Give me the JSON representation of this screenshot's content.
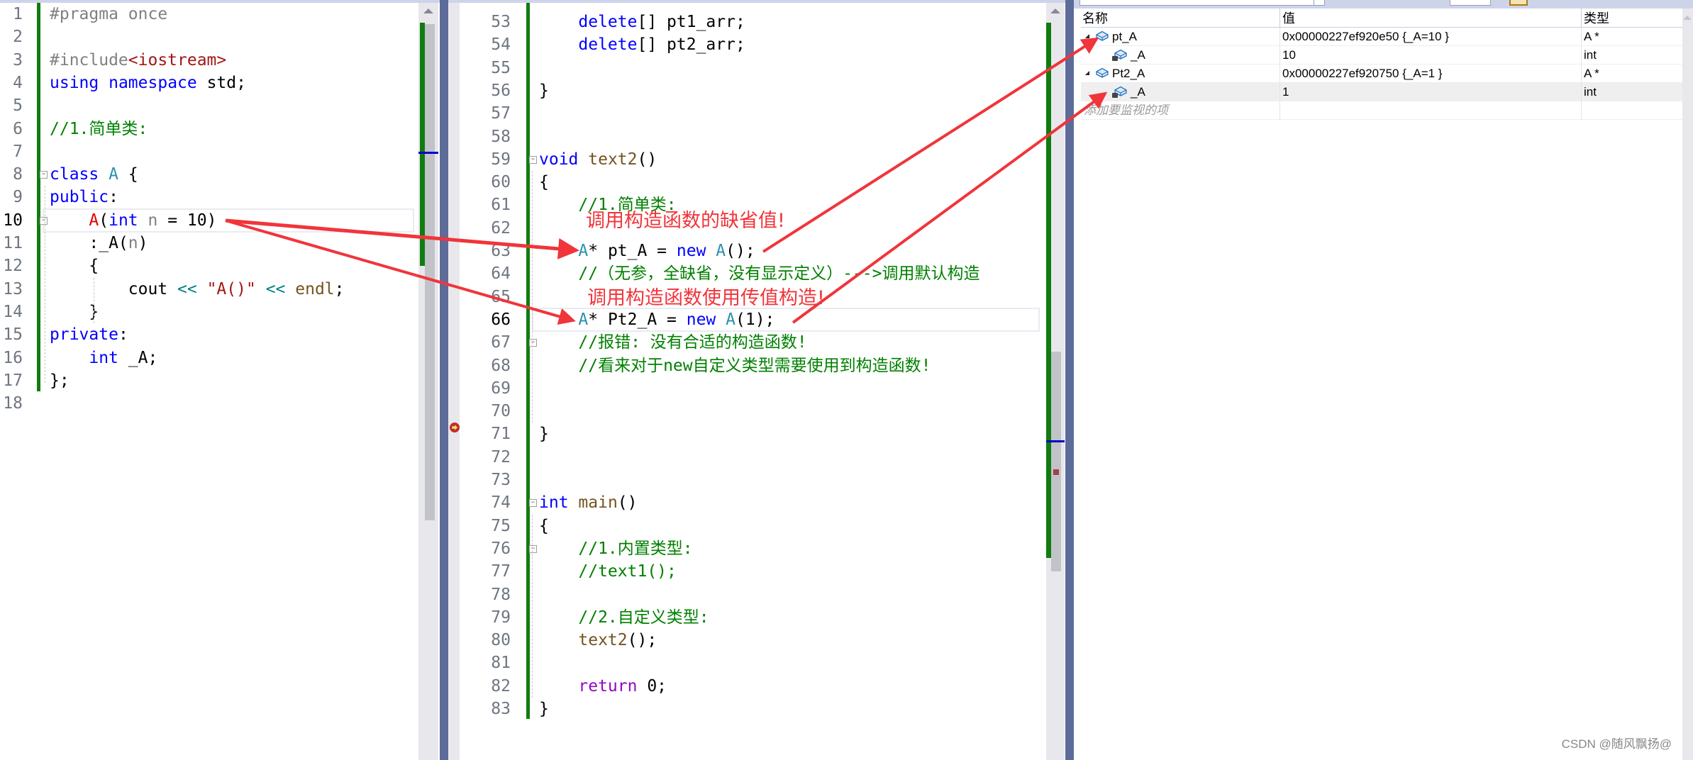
{
  "left_editor": {
    "current_line": 10,
    "lines": [
      {
        "n": "1",
        "tokens": [
          [
            "pre",
            "#pragma once"
          ]
        ]
      },
      {
        "n": "2",
        "tokens": []
      },
      {
        "n": "3",
        "tokens": [
          [
            "pre",
            "#include"
          ],
          [
            "s",
            "<iostream>"
          ]
        ]
      },
      {
        "n": "4",
        "tokens": [
          [
            "k",
            "using"
          ],
          [
            "d",
            " "
          ],
          [
            "k",
            "namespace"
          ],
          [
            "d",
            " std;"
          ]
        ]
      },
      {
        "n": "5",
        "tokens": []
      },
      {
        "n": "6",
        "tokens": [
          [
            "c",
            "//1.简单类:"
          ]
        ]
      },
      {
        "n": "7",
        "tokens": []
      },
      {
        "n": "8",
        "tokens": [
          [
            "k",
            "class"
          ],
          [
            "d",
            " "
          ],
          [
            "t",
            "A"
          ],
          [
            "d",
            " {"
          ]
        ]
      },
      {
        "n": "9",
        "tokens": [
          [
            "k",
            "public"
          ],
          [
            "d",
            ":"
          ]
        ]
      },
      {
        "n": "10",
        "tokens": [
          [
            "d",
            "    "
          ],
          [
            "r",
            "A"
          ],
          [
            "d",
            "("
          ],
          [
            "k",
            "int"
          ],
          [
            "d",
            " "
          ],
          [
            "p",
            "n"
          ],
          [
            "d",
            " = 10)"
          ]
        ]
      },
      {
        "n": "11",
        "tokens": [
          [
            "d",
            "    :_A("
          ],
          [
            "p",
            "n"
          ],
          [
            "d",
            ")"
          ]
        ]
      },
      {
        "n": "12",
        "tokens": [
          [
            "d",
            "    {"
          ]
        ]
      },
      {
        "n": "13",
        "tokens": [
          [
            "d",
            "        cout "
          ],
          [
            "op",
            "<<"
          ],
          [
            "d",
            " "
          ],
          [
            "s",
            "\"A()\""
          ],
          [
            "d",
            " "
          ],
          [
            "op",
            "<<"
          ],
          [
            "d",
            " "
          ],
          [
            "f",
            "endl"
          ],
          [
            "d",
            ";"
          ]
        ]
      },
      {
        "n": "14",
        "tokens": [
          [
            "d",
            "    }"
          ]
        ]
      },
      {
        "n": "15",
        "tokens": [
          [
            "k",
            "private"
          ],
          [
            "d",
            ":"
          ]
        ]
      },
      {
        "n": "16",
        "tokens": [
          [
            "d",
            "    "
          ],
          [
            "k",
            "int"
          ],
          [
            "d",
            " _A;"
          ]
        ]
      },
      {
        "n": "17",
        "tokens": [
          [
            "d",
            "};"
          ]
        ]
      },
      {
        "n": "18",
        "tokens": []
      }
    ]
  },
  "mid_editor": {
    "current_line": 66,
    "lines": [
      {
        "n": "53",
        "tokens": [
          [
            "d",
            "    "
          ],
          [
            "k",
            "delete"
          ],
          [
            "d",
            "[] pt1_arr;"
          ]
        ]
      },
      {
        "n": "54",
        "tokens": [
          [
            "d",
            "    "
          ],
          [
            "k",
            "delete"
          ],
          [
            "d",
            "[] pt2_arr;"
          ]
        ]
      },
      {
        "n": "55",
        "tokens": []
      },
      {
        "n": "56",
        "tokens": [
          [
            "d",
            "}"
          ]
        ]
      },
      {
        "n": "57",
        "tokens": []
      },
      {
        "n": "58",
        "tokens": []
      },
      {
        "n": "59",
        "tokens": [
          [
            "k",
            "void"
          ],
          [
            "d",
            " "
          ],
          [
            "f",
            "text2"
          ],
          [
            "d",
            "()"
          ]
        ]
      },
      {
        "n": "60",
        "tokens": [
          [
            "d",
            "{"
          ]
        ]
      },
      {
        "n": "61",
        "tokens": [
          [
            "d",
            "    "
          ],
          [
            "c",
            "//1.简单类:"
          ]
        ]
      },
      {
        "n": "62",
        "tokens": []
      },
      {
        "n": "63",
        "tokens": [
          [
            "d",
            "    "
          ],
          [
            "t",
            "A"
          ],
          [
            "d",
            "* pt_A = "
          ],
          [
            "k",
            "new"
          ],
          [
            "d",
            " "
          ],
          [
            "t",
            "A"
          ],
          [
            "d",
            "();"
          ]
        ]
      },
      {
        "n": "64",
        "tokens": [
          [
            "d",
            "    "
          ],
          [
            "c",
            "//（无参，全缺省，没有显示定义）--->调用默认构造"
          ]
        ]
      },
      {
        "n": "65",
        "tokens": []
      },
      {
        "n": "66",
        "tokens": [
          [
            "d",
            "    "
          ],
          [
            "t",
            "A"
          ],
          [
            "d",
            "* Pt2_A = "
          ],
          [
            "k",
            "new"
          ],
          [
            "d",
            " "
          ],
          [
            "t",
            "A"
          ],
          [
            "d",
            "(1);"
          ]
        ]
      },
      {
        "n": "67",
        "tokens": [
          [
            "d",
            "    "
          ],
          [
            "c",
            "//报错: 没有合适的构造函数!"
          ]
        ]
      },
      {
        "n": "68",
        "tokens": [
          [
            "d",
            "    "
          ],
          [
            "c",
            "//看来对于new自定义类型需要使用到构造函数!"
          ]
        ]
      },
      {
        "n": "69",
        "tokens": []
      },
      {
        "n": "70",
        "tokens": []
      },
      {
        "n": "71",
        "tokens": [
          [
            "d",
            "}"
          ]
        ]
      },
      {
        "n": "72",
        "tokens": []
      },
      {
        "n": "73",
        "tokens": []
      },
      {
        "n": "74",
        "tokens": [
          [
            "k",
            "int"
          ],
          [
            "d",
            " "
          ],
          [
            "f",
            "main"
          ],
          [
            "d",
            "()"
          ]
        ]
      },
      {
        "n": "75",
        "tokens": [
          [
            "d",
            "{"
          ]
        ]
      },
      {
        "n": "76",
        "tokens": [
          [
            "d",
            "    "
          ],
          [
            "c",
            "//1.内置类型:"
          ]
        ]
      },
      {
        "n": "77",
        "tokens": [
          [
            "d",
            "    "
          ],
          [
            "c",
            "//text1();"
          ]
        ]
      },
      {
        "n": "78",
        "tokens": []
      },
      {
        "n": "79",
        "tokens": [
          [
            "d",
            "    "
          ],
          [
            "c",
            "//2.自定义类型:"
          ]
        ]
      },
      {
        "n": "80",
        "tokens": [
          [
            "d",
            "    "
          ],
          [
            "f",
            "text2"
          ],
          [
            "d",
            "();"
          ]
        ]
      },
      {
        "n": "81",
        "tokens": []
      },
      {
        "n": "82",
        "tokens": [
          [
            "d",
            "    "
          ],
          [
            "ret",
            "return"
          ],
          [
            "d",
            " 0;"
          ]
        ]
      },
      {
        "n": "83",
        "tokens": [
          [
            "d",
            "}"
          ]
        ]
      }
    ]
  },
  "annotations": {
    "default_value": "调用构造函数的缺省值!",
    "pass_value": "调用构造函数使用传值构造!"
  },
  "watch": {
    "headers": {
      "name": "名称",
      "value": "值",
      "type": "类型"
    },
    "rows": [
      {
        "name": "pt_A",
        "value": "0x00000227ef920e50 {_A=10 }",
        "type": "A *",
        "level": 0,
        "expanded": true
      },
      {
        "name": "_A",
        "value": "10",
        "type": "int",
        "level": 1,
        "expanded": false
      },
      {
        "name": "Pt2_A",
        "value": "0x00000227ef920750 {_A=1 }",
        "type": "A *",
        "level": 0,
        "expanded": true
      },
      {
        "name": "_A",
        "value": "1",
        "type": "int",
        "level": 1,
        "expanded": false
      }
    ],
    "add_item_placeholder": "添加要监视的项"
  },
  "watermark": "CSDN @随风飘扬@",
  "colors": {
    "annotation_red": "#f0353b",
    "change_bar": "#107c10",
    "splitter": "#5d6b99"
  }
}
